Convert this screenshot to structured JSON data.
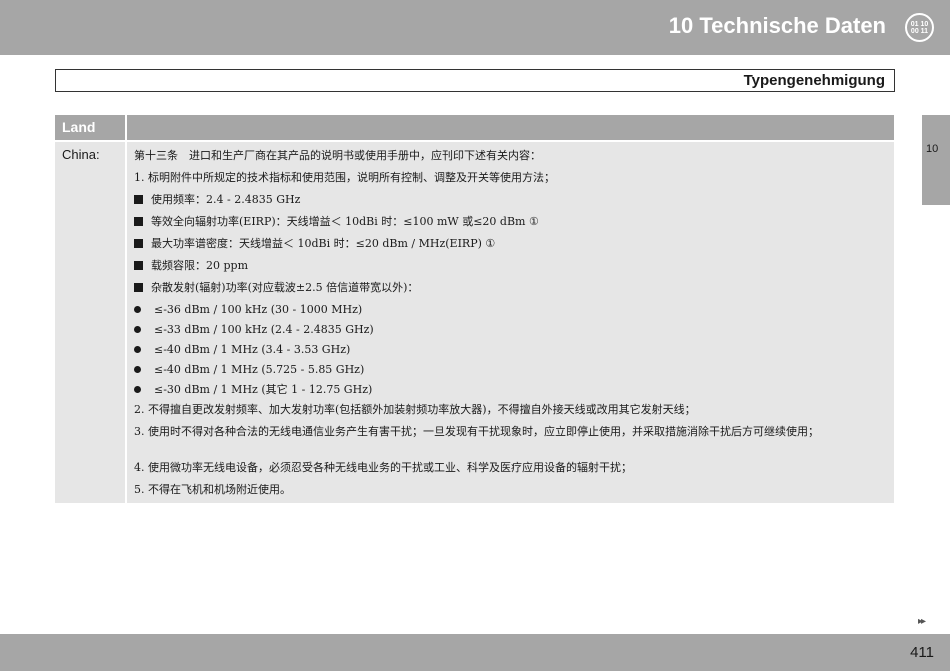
{
  "header": {
    "chapter_title": "10 Technische Daten",
    "icon_line1": "01 10",
    "icon_line2": "00 11"
  },
  "section": {
    "title": "Typengenehmigung"
  },
  "table": {
    "column_header": "Land",
    "land": "China:",
    "lines": [
      {
        "bullet": "none",
        "text": "第十三条　进口和生产厂商在其产品的说明书或使用手册中，应刊印下述有关内容："
      },
      {
        "bullet": "none",
        "text": "1. 标明附件中所规定的技术指标和使用范围，说明所有控制、调整及开关等使用方法；"
      },
      {
        "bullet": "square",
        "text": "使用频率：2.4 - 2.4835 GHz"
      },
      {
        "bullet": "square",
        "text": "等效全向辐射功率(EIRP)：天线增益＜ 10dBi 时：≤100 mW 或≤20 dBm ①"
      },
      {
        "bullet": "square",
        "text": "最大功率谱密度：天线增益＜ 10dBi 时：≤20 dBm / MHz(EIRP) ①"
      },
      {
        "bullet": "square",
        "text": "载频容限：20 ppm"
      },
      {
        "bullet": "square",
        "text": "杂散发射(辐射)功率(对应载波±2.5 倍信道带宽以外)："
      },
      {
        "bullet": "dot",
        "text": "≤-36 dBm / 100 kHz (30 - 1000 MHz)"
      },
      {
        "bullet": "dot",
        "text": "≤-33 dBm / 100 kHz (2.4 - 2.4835 GHz)"
      },
      {
        "bullet": "dot",
        "text": "≤-40 dBm / 1 MHz (3.4 - 3.53 GHz)"
      },
      {
        "bullet": "dot",
        "text": "≤-40 dBm / 1 MHz (5.725 - 5.85 GHz)"
      },
      {
        "bullet": "dot",
        "text": "≤-30 dBm / 1 MHz (其它 1 - 12.75 GHz)"
      },
      {
        "bullet": "none",
        "text": "2. 不得擅自更改发射频率、加大发射功率(包括额外加装射频功率放大器)，不得擅自外接天线或改用其它发射天线；"
      },
      {
        "bullet": "none",
        "text": "3. 使用时不得对各种合法的无线电通信业务产生有害干扰；一旦发现有干扰现象时，应立即停止使用，并采取措施消除干扰后方可继续使用；"
      },
      {
        "bullet": "none",
        "text": "4. 使用微功率无线电设备，必须忍受各种无线电业务的干扰或工业、科学及医疗应用设备的辐射干扰；"
      },
      {
        "bullet": "none",
        "text": "5. 不得在飞机和机场附近使用。"
      }
    ]
  },
  "side_tab": {
    "label": "10"
  },
  "footer": {
    "next_arrow": "▸▸",
    "page_number": "411"
  },
  "colors": {
    "bar_gray": "#a6a6a6",
    "cell_gray": "#e6e6e6"
  }
}
